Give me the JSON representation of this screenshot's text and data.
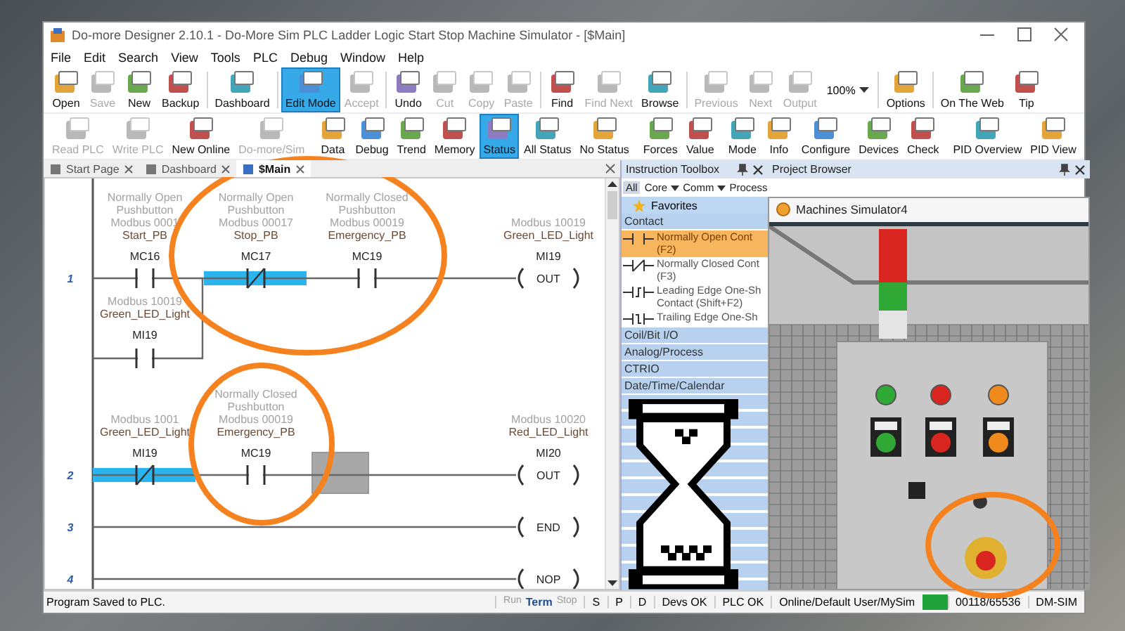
{
  "window": {
    "title": "Do-more Designer 2.10.1 - Do-More Sim PLC Ladder Logic Start Stop Machine Simulator - [$Main]"
  },
  "menu": [
    "File",
    "Edit",
    "Search",
    "View",
    "Tools",
    "PLC",
    "Debug",
    "Window",
    "Help"
  ],
  "toolbar_rows": [
    [
      {
        "kind": "button",
        "label": "Open",
        "disabled": false,
        "selected": false
      },
      {
        "kind": "button",
        "label": "Save",
        "disabled": true,
        "selected": false
      },
      {
        "kind": "button",
        "label": "New",
        "disabled": false,
        "selected": false
      },
      {
        "kind": "button",
        "label": "Backup",
        "disabled": false,
        "selected": false
      },
      {
        "kind": "separator"
      },
      {
        "kind": "button",
        "label": "Dashboard",
        "disabled": false,
        "selected": false
      },
      {
        "kind": "separator"
      },
      {
        "kind": "button",
        "label": "Edit Mode",
        "disabled": false,
        "selected": true
      },
      {
        "kind": "button",
        "label": "Accept",
        "disabled": true,
        "selected": false
      },
      {
        "kind": "separator"
      },
      {
        "kind": "button",
        "label": "Undo",
        "disabled": false,
        "selected": false
      },
      {
        "kind": "button",
        "label": "Cut",
        "disabled": true,
        "selected": false
      },
      {
        "kind": "button",
        "label": "Copy",
        "disabled": true,
        "selected": false
      },
      {
        "kind": "button",
        "label": "Paste",
        "disabled": true,
        "selected": false
      },
      {
        "kind": "separator"
      },
      {
        "kind": "button",
        "label": "Find",
        "disabled": false,
        "selected": false
      },
      {
        "kind": "button",
        "label": "Find Next",
        "disabled": true,
        "selected": false
      },
      {
        "kind": "button",
        "label": "Browse",
        "disabled": false,
        "selected": false
      },
      {
        "kind": "separator"
      },
      {
        "kind": "button",
        "label": "Previous",
        "disabled": true,
        "selected": false
      },
      {
        "kind": "button",
        "label": "Next",
        "disabled": true,
        "selected": false
      },
      {
        "kind": "button",
        "label": "Output",
        "disabled": true,
        "selected": false
      },
      {
        "kind": "zoom",
        "value": "100%"
      },
      {
        "kind": "separator"
      },
      {
        "kind": "button",
        "label": "Options",
        "disabled": false,
        "selected": false
      },
      {
        "kind": "separator"
      },
      {
        "kind": "button",
        "label": "On The Web",
        "disabled": false,
        "selected": false
      },
      {
        "kind": "button",
        "label": "Tip",
        "disabled": false,
        "selected": false
      }
    ],
    [
      {
        "kind": "button",
        "label": "Read PLC",
        "disabled": true,
        "selected": false
      },
      {
        "kind": "button",
        "label": "Write PLC",
        "disabled": true,
        "selected": false
      },
      {
        "kind": "button",
        "label": "New Online",
        "disabled": false,
        "selected": false
      },
      {
        "kind": "button",
        "label": "Do-more/Sim",
        "disabled": true,
        "selected": false
      },
      {
        "kind": "separator"
      },
      {
        "kind": "button",
        "label": "Data",
        "disabled": false,
        "selected": false
      },
      {
        "kind": "button",
        "label": "Debug",
        "disabled": false,
        "selected": false
      },
      {
        "kind": "button",
        "label": "Trend",
        "disabled": false,
        "selected": false
      },
      {
        "kind": "button",
        "label": "Memory",
        "disabled": false,
        "selected": false
      },
      {
        "kind": "button",
        "label": "Status",
        "disabled": false,
        "selected": true
      },
      {
        "kind": "button",
        "label": "All Status",
        "disabled": false,
        "selected": false
      },
      {
        "kind": "button",
        "label": "No Status",
        "disabled": false,
        "selected": false
      },
      {
        "kind": "separator"
      },
      {
        "kind": "button",
        "label": "Forces",
        "disabled": false,
        "selected": false
      },
      {
        "kind": "button",
        "label": "Value",
        "disabled": false,
        "selected": false
      },
      {
        "kind": "separator"
      },
      {
        "kind": "button",
        "label": "Mode",
        "disabled": false,
        "selected": false
      },
      {
        "kind": "button",
        "label": "Info",
        "disabled": false,
        "selected": false
      },
      {
        "kind": "button",
        "label": "Configure",
        "disabled": false,
        "selected": false
      },
      {
        "kind": "button",
        "label": "Devices",
        "disabled": false,
        "selected": false
      },
      {
        "kind": "button",
        "label": "Check",
        "disabled": false,
        "selected": false
      },
      {
        "kind": "separator"
      },
      {
        "kind": "button",
        "label": "PID Overview",
        "disabled": false,
        "selected": false
      },
      {
        "kind": "button",
        "label": "PID View",
        "disabled": false,
        "selected": false
      }
    ]
  ],
  "tabs": [
    {
      "label": "Start Page",
      "selected": false
    },
    {
      "label": "Dashboard",
      "selected": false
    },
    {
      "label": "$Main",
      "selected": true
    }
  ],
  "ladder": {
    "rungs": [
      {
        "number": "1",
        "contacts": [
          {
            "kind": "no",
            "comment": [
              "Normally Open",
              "Pushbutton"
            ],
            "modbus": "Modbus 0001",
            "nickname": "Start_PB",
            "address": "MC16",
            "energized": false
          },
          {
            "kind": "nc",
            "comment": [
              "Normally Open",
              "Pushbutton"
            ],
            "modbus": "Modbus 00017",
            "nickname": "Stop_PB",
            "address": "MC17",
            "energized": true
          },
          {
            "kind": "no",
            "comment": [
              "Normally Closed",
              "Pushbutton"
            ],
            "modbus": "Modbus 00019",
            "nickname": "Emergency_PB",
            "address": "MC19",
            "energized": false
          }
        ],
        "branch": [
          {
            "kind": "no",
            "modbus": "Modbus 10019",
            "nickname": "Green_LED_Light",
            "address": "MI19",
            "energized": false
          }
        ],
        "coil": {
          "instruction": "OUT",
          "modbus": "Modbus 10019",
          "nickname": "Green_LED_Light",
          "address": "MI19"
        },
        "cursor": false
      },
      {
        "number": "2",
        "contacts": [
          {
            "kind": "nc",
            "modbus": "Modbus 1001",
            "nickname": "Green_LED_Light",
            "address": "MI19",
            "energized": true
          },
          {
            "kind": "no",
            "comment": [
              "Normally Closed",
              "Pushbutton"
            ],
            "modbus": "Modbus 00019",
            "nickname": "Emergency_PB",
            "address": "MC19",
            "energized": false
          }
        ],
        "coil": {
          "instruction": "OUT",
          "modbus": "Modbus 10020",
          "nickname": "Red_LED_Light",
          "address": "MI20"
        },
        "cursor": true
      },
      {
        "number": "3",
        "coil": {
          "instruction": "END"
        },
        "cursor": false
      },
      {
        "number": "4",
        "coil": {
          "instruction": "NOP"
        },
        "cursor": false
      }
    ]
  },
  "toolbox": {
    "title": "Instruction Toolbox",
    "filters": [
      {
        "label": "All",
        "selected": true,
        "dropdown": false
      },
      {
        "label": "Core",
        "selected": false,
        "dropdown": true
      },
      {
        "label": "Comm",
        "selected": false,
        "dropdown": true
      },
      {
        "label": "Process",
        "selected": false,
        "dropdown": false
      }
    ],
    "items": [
      {
        "kind": "favorites",
        "label": "Favorites"
      },
      {
        "kind": "category",
        "label": "Contact"
      },
      {
        "kind": "normally_open",
        "label": "Normally Open Cont",
        "shortcut": "(F2)",
        "selected": true
      },
      {
        "kind": "normally_closed",
        "label": "Normally Closed Cont",
        "shortcut": "(F3)",
        "selected": false
      },
      {
        "kind": "leading_edge",
        "label": "Leading Edge One-Sh",
        "shortcut": "Contact (Shift+F2)",
        "selected": false
      },
      {
        "kind": "trailing_edge",
        "label": "Trailing Edge One-Sh",
        "selected": false
      },
      {
        "kind": "category",
        "label": "Coil/Bit I/O"
      },
      {
        "kind": "category",
        "label": "Analog/Process"
      },
      {
        "kind": "category",
        "label": "CTRIO"
      },
      {
        "kind": "category",
        "label": "Date/Time/Calendar"
      }
    ]
  },
  "project_browser": {
    "title": "Project Browser"
  },
  "simulator": {
    "title": "Machines Simulator4"
  },
  "status_bar": {
    "message": "Program Saved to PLC.",
    "modes": [
      {
        "label": "Run",
        "selected": false
      },
      {
        "label": "Term",
        "selected": true
      },
      {
        "label": "Stop",
        "selected": false
      }
    ],
    "flags": [
      "S",
      "P",
      "D"
    ],
    "fields": [
      "Devs OK",
      "PLC OK",
      "Online/Default User/MySim"
    ],
    "link": {
      "on": true
    },
    "memory": "00118/65536",
    "mode": "DM-SIM"
  }
}
